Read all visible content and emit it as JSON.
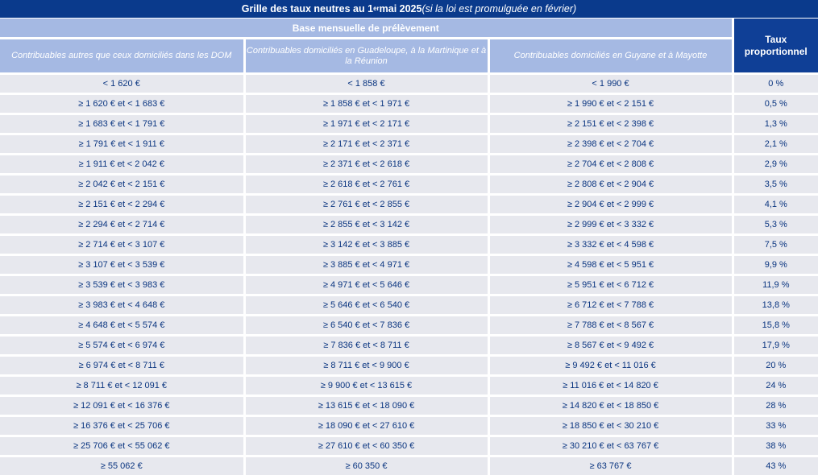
{
  "title": {
    "main": "Grille des taux neutres au 1",
    "sup": "er",
    "main_end": " mai 2025 ",
    "note": "(si la loi est promulguée en février)"
  },
  "header": {
    "band": "Base mensuelle de prélèvement",
    "rate": "Taux proportionnel",
    "columns": [
      "Contribuables autres que ceux domiciliés dans les DOM",
      "Contribuables domiciliés en Guadeloupe, à la Martinique et à la Réunion",
      "Contribuables domiciliés en Guyane et à Mayotte"
    ]
  },
  "rows": [
    {
      "a": "< 1 620 €",
      "b": "< 1 858 €",
      "c": "< 1 990 €",
      "rate": "0 %"
    },
    {
      "a": "≥ 1 620 € et < 1 683 €",
      "b": "≥ 1 858 € et < 1 971 €",
      "c": "≥ 1 990 € et < 2 151 €",
      "rate": "0,5 %"
    },
    {
      "a": "≥ 1 683 € et < 1 791 €",
      "b": "≥ 1 971 € et < 2 171 €",
      "c": "≥ 2 151 € et < 2 398 €",
      "rate": "1,3 %"
    },
    {
      "a": "≥ 1 791 € et < 1 911 €",
      "b": "≥ 2 171 € et < 2 371 €",
      "c": "≥ 2 398 € et < 2 704 €",
      "rate": "2,1 %"
    },
    {
      "a": "≥ 1 911 € et < 2 042 €",
      "b": "≥ 2 371 € et < 2 618 €",
      "c": "≥ 2 704 € et < 2 808 €",
      "rate": "2,9 %"
    },
    {
      "a": "≥ 2 042 € et < 2 151 €",
      "b": "≥ 2 618 € et < 2 761 €",
      "c": "≥ 2 808 € et < 2 904 €",
      "rate": "3,5 %"
    },
    {
      "a": "≥ 2 151 € et < 2 294 €",
      "b": "≥ 2 761 € et < 2 855 €",
      "c": "≥ 2 904 € et < 2 999 €",
      "rate": "4,1 %"
    },
    {
      "a": "≥ 2 294 € et < 2 714 €",
      "b": "≥ 2 855 € et < 3 142 €",
      "c": "≥ 2 999 € et < 3 332 €",
      "rate": "5,3 %"
    },
    {
      "a": "≥ 2 714 € et < 3 107 €",
      "b": "≥ 3 142 € et < 3 885 €",
      "c": "≥ 3 332 € et < 4 598 €",
      "rate": "7,5 %"
    },
    {
      "a": "≥ 3 107 € et < 3 539 €",
      "b": "≥ 3 885 € et < 4 971 €",
      "c": "≥ 4 598 € et < 5 951 €",
      "rate": "9,9 %"
    },
    {
      "a": "≥ 3 539 € et < 3 983 €",
      "b": "≥ 4 971 € et < 5 646 €",
      "c": "≥ 5 951 € et < 6 712 €",
      "rate": "11,9 %"
    },
    {
      "a": "≥ 3 983 € et < 4 648 €",
      "b": "≥ 5 646 € et < 6 540 €",
      "c": "≥ 6 712 € et < 7 788 €",
      "rate": "13,8 %"
    },
    {
      "a": "≥ 4 648 € et < 5 574 €",
      "b": "≥ 6 540 € et < 7 836 €",
      "c": "≥ 7 788 € et < 8 567 €",
      "rate": "15,8 %"
    },
    {
      "a": "≥ 5 574 € et < 6 974 €",
      "b": "≥ 7 836 € et < 8 711 €",
      "c": "≥ 8 567 € et < 9 492 €",
      "rate": "17,9 %"
    },
    {
      "a": "≥ 6 974 € et < 8 711 €",
      "b": "≥ 8 711 € et < 9 900 €",
      "c": "≥ 9 492 € et < 11 016 €",
      "rate": "20 %"
    },
    {
      "a": "≥ 8 711 € et < 12 091 €",
      "b": "≥ 9 900 € et < 13 615 €",
      "c": "≥ 11 016 € et < 14 820 €",
      "rate": "24 %"
    },
    {
      "a": "≥ 12 091 € et < 16 376 €",
      "b": "≥ 13 615 € et < 18 090 €",
      "c": "≥ 14 820 € et < 18 850 €",
      "rate": "28 %"
    },
    {
      "a": "≥ 16 376 € et < 25 706 €",
      "b": "≥ 18 090 € et < 27 610 €",
      "c": "≥ 18 850 € et < 30 210 €",
      "rate": "33 %"
    },
    {
      "a": "≥ 25 706 € et < 55 062 €",
      "b": "≥ 27 610 € et < 60 350 €",
      "c": "≥ 30 210 € et < 63 767 €",
      "rate": "38 %"
    },
    {
      "a": "≥ 55 062 €",
      "b": "≥ 60 350 €",
      "c": "≥ 63 767 €",
      "rate": "43 %"
    }
  ]
}
